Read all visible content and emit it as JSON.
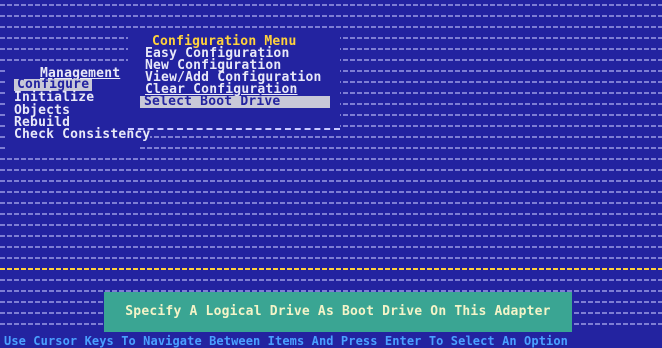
{
  "management_menu": {
    "title": "Management",
    "items": [
      "Configure",
      "Initialize",
      "Objects",
      "Rebuild",
      "Check Consistency"
    ],
    "selected": "Configure"
  },
  "config_menu": {
    "title": "Configuration Menu",
    "items": [
      "Easy Configuration",
      "New Configuration",
      "View/Add Configuration",
      "Clear Configuration",
      "Select Boot Drive"
    ],
    "selected": "Select Boot Drive"
  },
  "status_message": "Specify A Logical Drive As Boot Drive On This Adapter",
  "footer_hint": "Use Cursor Keys To Navigate Between Items And Press Enter To Select An Option",
  "colors": {
    "background": "#2323a0",
    "highlight": "#c8c8d8",
    "title_yellow": "#ffd23c",
    "status_box": "#3aa593",
    "hint_blue": "#4aa0ff"
  }
}
